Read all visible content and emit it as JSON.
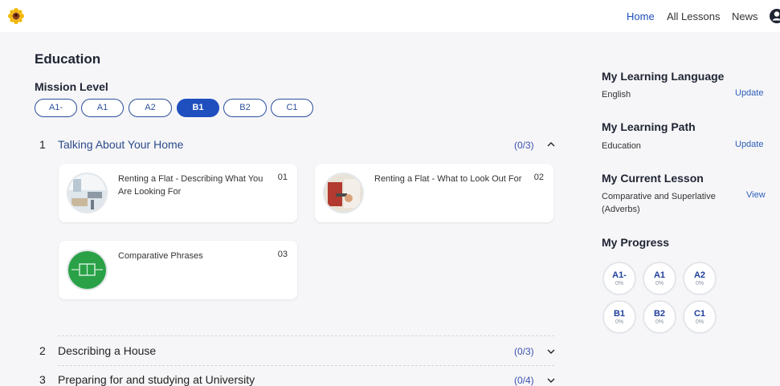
{
  "nav": {
    "home": "Home",
    "all_lessons": "All Lessons",
    "news": "News"
  },
  "page": {
    "title": "Education",
    "mission_level": "Mission Level"
  },
  "levels": [
    {
      "label": "A1-",
      "active": false
    },
    {
      "label": "A1",
      "active": false
    },
    {
      "label": "A2",
      "active": false
    },
    {
      "label": "B1",
      "active": true
    },
    {
      "label": "B2",
      "active": false
    },
    {
      "label": "C1",
      "active": false
    }
  ],
  "sections": [
    {
      "number": "1",
      "title": "Talking About Your Home",
      "count": "(0/3)",
      "expanded": true,
      "lessons": [
        {
          "title": "Renting a Flat - Describing What You Are Looking For",
          "number": "01",
          "thumb": "flat-interior-photo"
        },
        {
          "title": "Renting a Flat - What to Look Out For",
          "number": "02",
          "thumb": "flat-door-photo"
        },
        {
          "title": "Comparative Phrases",
          "number": "03",
          "thumb": "green-comparison-graphic"
        }
      ]
    },
    {
      "number": "2",
      "title": "Describing a House",
      "count": "(0/3)",
      "expanded": false
    },
    {
      "number": "3",
      "title": "Preparing for and studying at University",
      "count": "(0/4)",
      "expanded": false
    }
  ],
  "sidebar": {
    "language": {
      "heading": "My Learning Language",
      "value": "English",
      "action": "Update"
    },
    "path": {
      "heading": "My Learning Path",
      "value": "Education",
      "action": "Update"
    },
    "lesson": {
      "heading": "My Current Lesson",
      "value": "Comparative and Superlative (Adverbs)",
      "action": "View"
    },
    "progress": {
      "heading": "My Progress",
      "items": [
        {
          "level": "A1-",
          "percent": "0%"
        },
        {
          "level": "A1",
          "percent": "0%"
        },
        {
          "level": "A2",
          "percent": "0%"
        },
        {
          "level": "B1",
          "percent": "0%"
        },
        {
          "level": "B2",
          "percent": "0%"
        },
        {
          "level": "C1",
          "percent": "0%"
        }
      ]
    }
  },
  "colors": {
    "accent": "#1f4fbf",
    "link": "#2c5fb8",
    "background": "#f6f6f8"
  },
  "icons": {
    "logo": "sunflower-logo-icon",
    "user": "user-account-icon",
    "expanded": "chevron-up-icon",
    "collapsed": "chevron-down-icon"
  }
}
